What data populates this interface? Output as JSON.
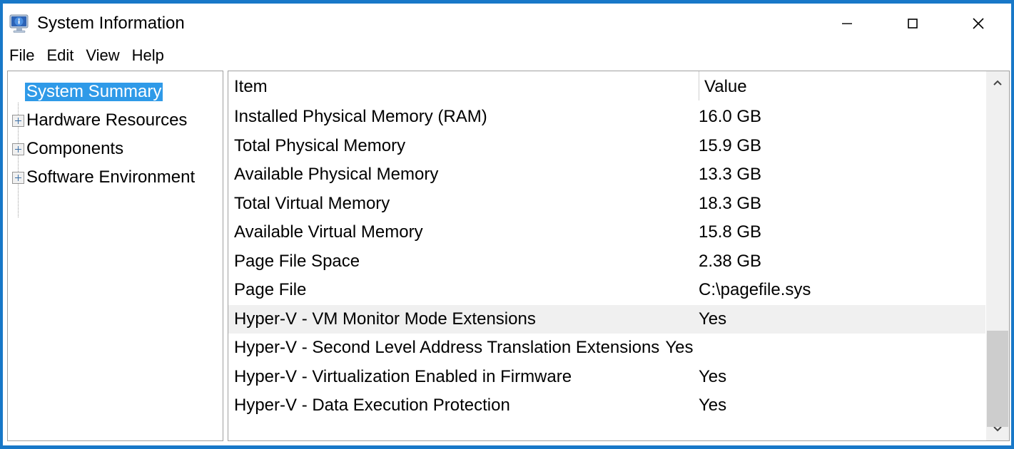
{
  "window": {
    "title": "System Information",
    "icon": "system-information-icon",
    "accent_color": "#1878c8",
    "controls": [
      {
        "name": "minimize-button",
        "glyph": "minimize-icon"
      },
      {
        "name": "maximize-button",
        "glyph": "maximize-icon"
      },
      {
        "name": "close-button",
        "glyph": "close-icon"
      }
    ]
  },
  "menubar": {
    "items": [
      {
        "label": "File"
      },
      {
        "label": "Edit"
      },
      {
        "label": "View"
      },
      {
        "label": "Help"
      }
    ]
  },
  "tree": {
    "selected_color": "#2f9ae8",
    "nodes": [
      {
        "label": "System Summary",
        "expandable": false,
        "selected": true
      },
      {
        "label": "Hardware Resources",
        "expandable": true,
        "selected": false
      },
      {
        "label": "Components",
        "expandable": true,
        "selected": false
      },
      {
        "label": "Software Environment",
        "expandable": true,
        "selected": false
      }
    ]
  },
  "list": {
    "columns": {
      "item": "Item",
      "value": "Value"
    },
    "hover_color": "#f0f0f0",
    "rows": [
      {
        "item": "Installed Physical Memory (RAM)",
        "value": "16.0 GB",
        "hovered": false,
        "wide": false
      },
      {
        "item": "Total Physical Memory",
        "value": "15.9 GB",
        "hovered": false,
        "wide": false
      },
      {
        "item": "Available Physical Memory",
        "value": "13.3 GB",
        "hovered": false,
        "wide": false
      },
      {
        "item": "Total Virtual Memory",
        "value": "18.3 GB",
        "hovered": false,
        "wide": false
      },
      {
        "item": "Available Virtual Memory",
        "value": "15.8 GB",
        "hovered": false,
        "wide": false
      },
      {
        "item": "Page File Space",
        "value": "2.38 GB",
        "hovered": false,
        "wide": false
      },
      {
        "item": "Page File",
        "value": "C:\\pagefile.sys",
        "hovered": false,
        "wide": false
      },
      {
        "item": "Hyper-V - VM Monitor Mode Extensions",
        "value": "Yes",
        "hovered": true,
        "wide": false
      },
      {
        "item": "Hyper-V - Second Level Address Translation Extensions",
        "value": "Yes",
        "hovered": false,
        "wide": true
      },
      {
        "item": "Hyper-V - Virtualization Enabled in Firmware",
        "value": "Yes",
        "hovered": false,
        "wide": false
      },
      {
        "item": "Hyper-V - Data Execution Protection",
        "value": "Yes",
        "hovered": false,
        "wide": false
      }
    ]
  },
  "scrollbar": {
    "up_arrow": "chevron-up-icon",
    "down_arrow": "chevron-down-icon",
    "thumb_top_pct": 71,
    "thumb_height_pct": 29
  }
}
